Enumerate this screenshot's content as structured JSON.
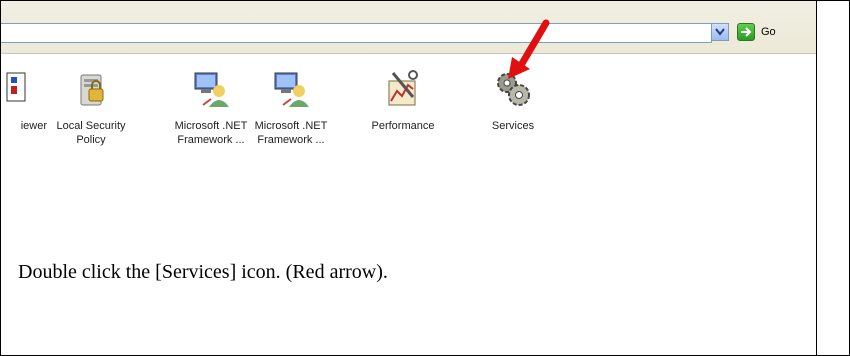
{
  "toolbar": {
    "go_label": "Go"
  },
  "items": [
    {
      "label_line1": "iewer",
      "label_line2": "",
      "icon": "viewer-icon"
    },
    {
      "label_line1": "Local Security",
      "label_line2": "Policy",
      "icon": "local-security-policy-icon"
    },
    {
      "label_line1": "Microsoft .NET",
      "label_line2": "Framework ...",
      "icon": "net-framework-icon"
    },
    {
      "label_line1": "Microsoft .NET",
      "label_line2": "Framework ...",
      "icon": "net-framework-icon"
    },
    {
      "label_line1": "Performance",
      "label_line2": "",
      "icon": "performance-icon"
    },
    {
      "label_line1": "Services",
      "label_line2": "",
      "icon": "services-gears-icon"
    }
  ],
  "annotation": {
    "arrow_color": "#e01010"
  },
  "instruction": "Double click the [Services] icon. (Red arrow)."
}
